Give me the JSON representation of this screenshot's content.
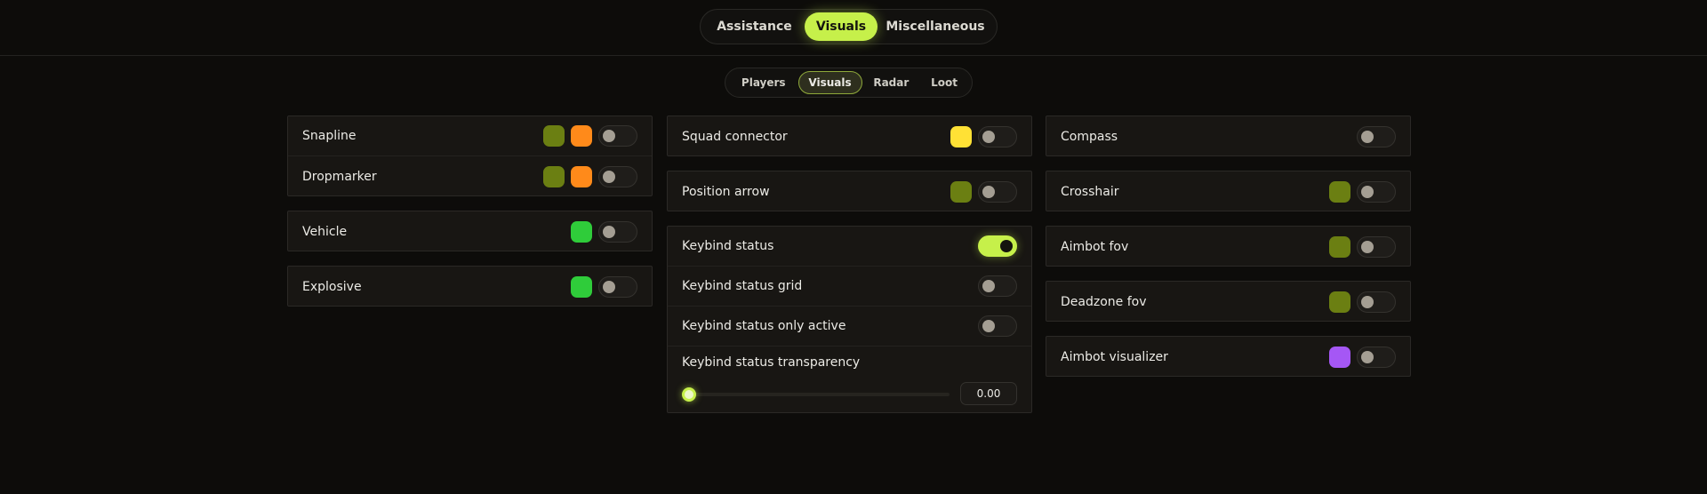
{
  "main_tabs": [
    "Assistance",
    "Visuals",
    "Miscellaneous"
  ],
  "main_tab_active": "Visuals",
  "sub_tabs": [
    "Players",
    "Visuals",
    "Radar",
    "Loot"
  ],
  "sub_tab_active": "Visuals",
  "colors": {
    "accent": "#c6f04a",
    "olive": "#6b7f12",
    "orange": "#ff8a1a",
    "green": "#2fcc3a",
    "yellow": "#ffe135",
    "purple": "#a557f5"
  },
  "col1": {
    "snapline": {
      "label": "Snapline",
      "colors": [
        "#6b7f12",
        "#ff8a1a"
      ],
      "enabled": false
    },
    "dropmarker": {
      "label": "Dropmarker",
      "colors": [
        "#6b7f12",
        "#ff8a1a"
      ],
      "enabled": false
    },
    "vehicle": {
      "label": "Vehicle",
      "colors": [
        "#2fcc3a"
      ],
      "enabled": false
    },
    "explosive": {
      "label": "Explosive",
      "colors": [
        "#2fcc3a"
      ],
      "enabled": false
    }
  },
  "col2": {
    "squad_connector": {
      "label": "Squad connector",
      "colors": [
        "#ffe135"
      ],
      "enabled": false
    },
    "position_arrow": {
      "label": "Position arrow",
      "colors": [
        "#6b7f12"
      ],
      "enabled": false
    },
    "keybind_status": {
      "label": "Keybind status",
      "enabled": true
    },
    "keybind_status_grid": {
      "label": "Keybind status grid",
      "enabled": false
    },
    "keybind_status_only_active": {
      "label": "Keybind status only active",
      "enabled": false
    },
    "keybind_status_transparency": {
      "label": "Keybind status transparency",
      "value": "0.00",
      "fraction": 0
    }
  },
  "col3": {
    "compass": {
      "label": "Compass",
      "enabled": false
    },
    "crosshair": {
      "label": "Crosshair",
      "colors": [
        "#6b7f12"
      ],
      "enabled": false
    },
    "aimbot_fov": {
      "label": "Aimbot fov",
      "colors": [
        "#6b7f12"
      ],
      "enabled": false
    },
    "deadzone_fov": {
      "label": "Deadzone fov",
      "colors": [
        "#6b7f12"
      ],
      "enabled": false
    },
    "aimbot_visualizer": {
      "label": "Aimbot visualizer",
      "colors": [
        "#a557f5"
      ],
      "enabled": false
    }
  }
}
